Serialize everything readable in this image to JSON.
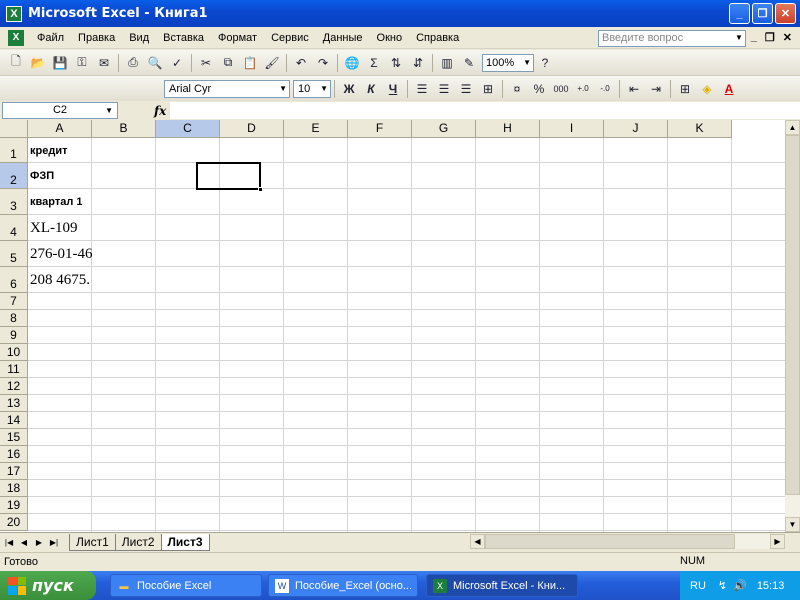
{
  "window": {
    "title": "Microsoft Excel - Книга1"
  },
  "menu": {
    "items": [
      "Файл",
      "Правка",
      "Вид",
      "Вставка",
      "Формат",
      "Сервис",
      "Данные",
      "Окно",
      "Справка"
    ],
    "help_placeholder": "Введите вопрос"
  },
  "toolbar": {
    "zoom": "100%",
    "font_name": "Arial Cyr",
    "font_size": "10",
    "bold_label": "Ж",
    "italic_label": "К",
    "underline_label": "Ч"
  },
  "formula_bar": {
    "name_box": "C2",
    "fx_label": "fx",
    "formula": ""
  },
  "columns": [
    "A",
    "B",
    "C",
    "D",
    "E",
    "F",
    "G",
    "H",
    "I",
    "J",
    "K"
  ],
  "active_column": "C",
  "rows": [
    "1",
    "2",
    "3",
    "4",
    "5",
    "6",
    "7",
    "8",
    "9",
    "10",
    "11",
    "12",
    "13",
    "14",
    "15",
    "16",
    "17",
    "18",
    "19",
    "20"
  ],
  "active_row": "2",
  "cells": {
    "A1": "кредит",
    "A2": "ФЗП",
    "A3": "квартал 1",
    "A4": "XL-109",
    "A5": "276-01-46",
    "A6": "208 4675."
  },
  "sheets": {
    "tabs": [
      "Лист1",
      "Лист2",
      "Лист3"
    ],
    "active": "Лист3"
  },
  "status": {
    "left": "Готово",
    "num": "NUM"
  },
  "taskbar": {
    "start_label": "пуск",
    "tasks": [
      "Пособие Excel",
      "Пособие_Excel (осно...",
      "Microsoft Excel - Кни..."
    ],
    "lang": "RU",
    "clock": "15:13"
  }
}
